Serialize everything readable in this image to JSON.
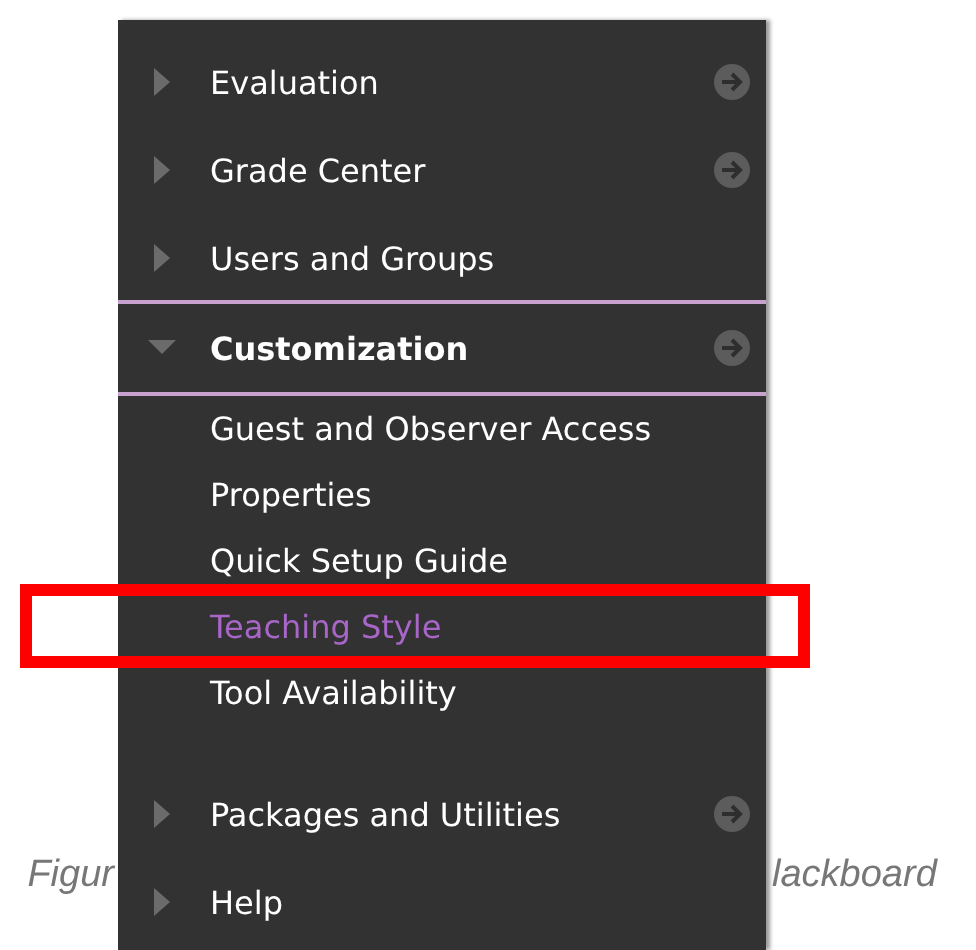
{
  "caption_left": "Figur",
  "caption_right": "lackboard",
  "menu": [
    {
      "label": "Evaluation",
      "expanded": false,
      "go": true
    },
    {
      "label": "Grade Center",
      "expanded": false,
      "go": true
    },
    {
      "label": "Users and Groups",
      "expanded": false,
      "go": false
    },
    {
      "label": "Customization",
      "expanded": true,
      "go": true,
      "children": [
        {
          "label": "Guest and Observer Access",
          "selected": false
        },
        {
          "label": "Properties",
          "selected": false
        },
        {
          "label": "Quick Setup Guide",
          "selected": false
        },
        {
          "label": "Teaching Style",
          "selected": true
        },
        {
          "label": "Tool Availability",
          "selected": false
        }
      ]
    },
    {
      "label": "Packages and Utilities",
      "expanded": false,
      "go": true
    },
    {
      "label": "Help",
      "expanded": false,
      "go": false
    }
  ]
}
